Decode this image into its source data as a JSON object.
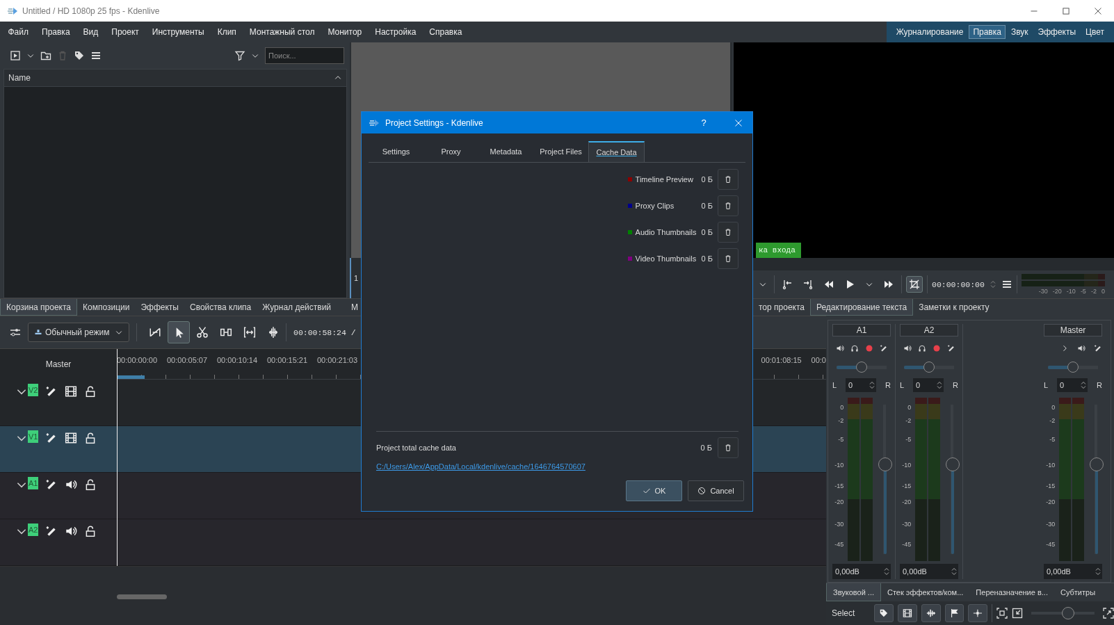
{
  "window": {
    "title": "Untitled / HD 1080p 25 fps - Kdenlive"
  },
  "menu": [
    "Файл",
    "Правка",
    "Вид",
    "Проект",
    "Инструменты",
    "Клип",
    "Монтажный стол",
    "Монитор",
    "Настройка",
    "Справка"
  ],
  "workspaces": [
    {
      "label": "Журналирование",
      "selected": false
    },
    {
      "label": "Правка",
      "selected": true
    },
    {
      "label": "Звук",
      "selected": false
    },
    {
      "label": "Эффекты",
      "selected": false
    },
    {
      "label": "Цвет",
      "selected": false
    }
  ],
  "bin": {
    "search_placeholder": "Поиск...",
    "column": "Name"
  },
  "left_tabs": [
    {
      "label": "Корзина проекта",
      "selected": true
    },
    {
      "label": "Композиции",
      "selected": false
    },
    {
      "label": "Эффекты",
      "selected": false
    },
    {
      "label": "Свойства клипа",
      "selected": false
    },
    {
      "label": "Журнал действий",
      "selected": false
    }
  ],
  "center_tabs": [
    {
      "label": "М",
      "selected": false
    }
  ],
  "project_monitor": {
    "fragment": "1"
  },
  "right_tabs": [
    {
      "label": "тор проекта",
      "selected": false
    },
    {
      "label": "Редактирование текста",
      "selected": true
    },
    {
      "label": "Заметки к проекту",
      "selected": false
    }
  ],
  "clip_monitor": {
    "overlay": "ка входа",
    "timecode": "00:00:00:00",
    "meter_scale": [
      "-30",
      "-20",
      "-10",
      "-5",
      "-2",
      "0"
    ],
    "controls": [
      {
        "kind": "dropdown",
        "selected": false
      },
      {
        "kind": "set-in",
        "selected": false
      },
      {
        "kind": "set-out",
        "selected": false
      },
      {
        "kind": "rewind",
        "selected": false
      },
      {
        "kind": "play",
        "selected": false
      },
      {
        "kind": "dropdown",
        "selected": false
      },
      {
        "kind": "forward",
        "selected": false
      },
      {
        "kind": "crop",
        "selected": true
      }
    ]
  },
  "timeline_toolbar": {
    "mode": "Обычный режим",
    "timecode": "00:00:58:24 /",
    "tools": [
      {
        "kind": "spacer",
        "selected": false
      },
      {
        "kind": "select",
        "selected": true
      },
      {
        "kind": "razor",
        "selected": false
      },
      {
        "kind": "ripple",
        "selected": false
      },
      {
        "kind": "slip",
        "selected": false
      },
      {
        "kind": "multicam",
        "selected": false
      }
    ]
  },
  "ruler": {
    "master": "Master",
    "left_labels": [
      "00:00:00:00",
      "00:00:05:07",
      "00:00:10:14",
      "00:00:15:21",
      "00:00:21:03"
    ],
    "right_labels": [
      "00:01:08:15",
      "00:0"
    ]
  },
  "tracks": [
    {
      "name": "V2",
      "kind": "video",
      "selected": false
    },
    {
      "name": "V1",
      "kind": "video",
      "selected": true
    },
    {
      "name": "A1",
      "kind": "audio",
      "selected": false
    },
    {
      "name": "A2",
      "kind": "audio",
      "selected": false
    }
  ],
  "mixer": [
    {
      "name": "A1",
      "kind": "track",
      "pan": {
        "level": 0.5
      },
      "pan_value": "0",
      "left": "L",
      "right": "R",
      "scale": [
        "0",
        "-2",
        "-5",
        "-10",
        "-15",
        "-20",
        "-30",
        "-45"
      ],
      "volume": {
        "level": 0.6
      },
      "gain": "0,00dB"
    },
    {
      "name": "A2",
      "kind": "track",
      "pan": {
        "level": 0.5
      },
      "pan_value": "0",
      "left": "L",
      "right": "R",
      "scale": [
        "0",
        "-2",
        "-5",
        "-10",
        "-15",
        "-20",
        "-30",
        "-45"
      ],
      "volume": {
        "level": 0.6
      },
      "gain": "0,00dB"
    },
    {
      "name": "Master",
      "kind": "master",
      "pan": {
        "level": 0.5
      },
      "pan_value": "0",
      "left": "L",
      "right": "R",
      "scale": [
        "0",
        "-2",
        "-5",
        "-10",
        "-15",
        "-20",
        "-30",
        "-45"
      ],
      "volume": {
        "level": 0.6
      },
      "gain": "0,00dB"
    }
  ],
  "bottom_tabs": [
    {
      "label": "Звуковой ...",
      "selected": true
    },
    {
      "label": "Стек эффектов/ком...",
      "selected": false
    },
    {
      "label": "Переназначение в...",
      "selected": false
    },
    {
      "label": "Субтитры",
      "selected": false
    }
  ],
  "status_bar": {
    "mode": "Select",
    "zoom": {
      "level": 0.57
    },
    "toggles": [
      {
        "kind": "tag"
      },
      {
        "kind": "film"
      },
      {
        "kind": "wave"
      },
      {
        "kind": "flag"
      },
      {
        "kind": "marker"
      }
    ]
  },
  "dialog": {
    "title": "Project Settings - Kdenlive",
    "help": "?",
    "tabs": [
      {
        "label": "Settings",
        "selected": false
      },
      {
        "label": "Proxy",
        "selected": false
      },
      {
        "label": "Metadata",
        "selected": false
      },
      {
        "label": "Project Files",
        "selected": false
      },
      {
        "label": "Cache Data",
        "selected": true
      }
    ],
    "cache": [
      {
        "label": "Timeline Preview",
        "size": "0 Б",
        "color": "#8b0000"
      },
      {
        "label": "Proxy Clips",
        "size": "0 Б",
        "color": "#00008b"
      },
      {
        "label": "Audio Thumbnails",
        "size": "0 Б",
        "color": "#008000"
      },
      {
        "label": "Video Thumbnails",
        "size": "0 Б",
        "color": "#800080"
      }
    ],
    "total": {
      "label": "Project total cache data",
      "size": "0 Б"
    },
    "path": "C:/Users/Alex/AppData/Local/kdenlive/cache/1646764570607",
    "ok": "OK",
    "cancel": "Cancel"
  }
}
